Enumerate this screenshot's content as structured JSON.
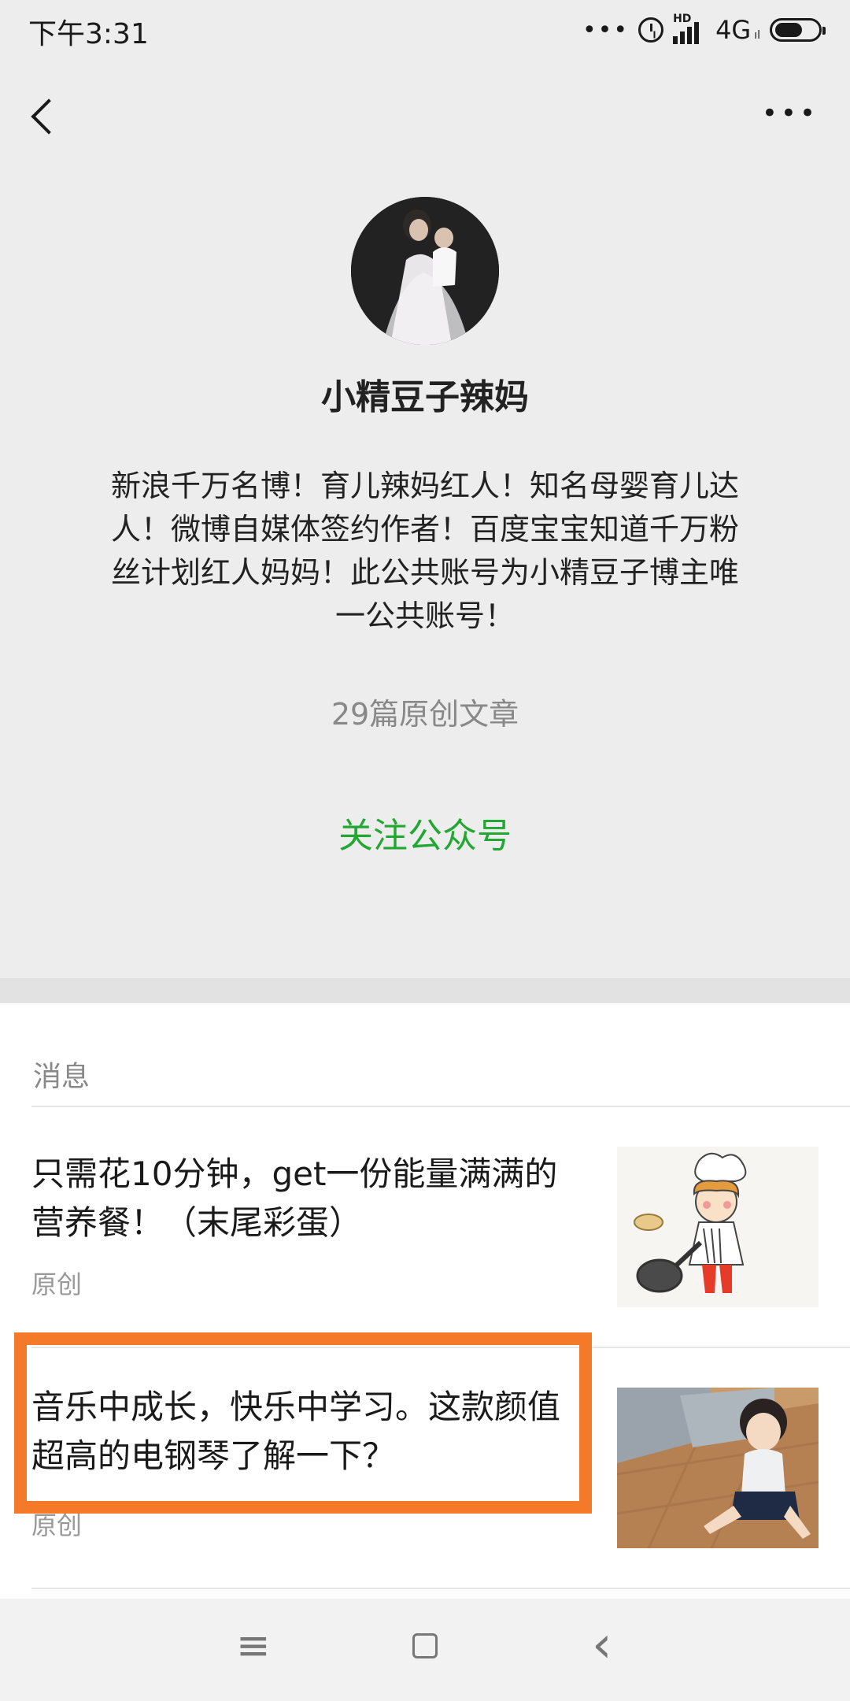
{
  "status_bar": {
    "time": "下午3:31",
    "dots": "•••",
    "network": "4G",
    "hd": "HD",
    "signal_sub": "ıl"
  },
  "header": {
    "back_icon": "back-chevron-icon",
    "more_label": "•••"
  },
  "profile": {
    "avatar_icon": "avatar-photo",
    "name": "小精豆子辣妈",
    "bio": "新浪千万名博！育儿辣妈红人！知名母婴育儿达人！微博自媒体签约作者！百度宝宝知道千万粉丝计划红人妈妈！此公共账号为小精豆子博主唯一公共账号！",
    "article_count": "29篇原创文章",
    "follow_label": "关注公众号"
  },
  "messages": {
    "section_title": "消息",
    "items": [
      {
        "title": "只需花10分钟，get一份能量满满的营养餐！（末尾彩蛋）",
        "tag": "原创",
        "highlighted": false,
        "thumb_icon": "chef-girl-illustration"
      },
      {
        "title": "音乐中成长，快乐中学习。这款颜值超高的电钢琴了解一下？",
        "tag": "原创",
        "highlighted": true,
        "thumb_icon": "girl-photo"
      }
    ]
  },
  "nav": {
    "menu_label": "≡",
    "back_label": "‹"
  },
  "colors": {
    "accent_green": "#22a832",
    "highlight_orange": "#f47a2a",
    "divider_gray": "#ededed"
  }
}
